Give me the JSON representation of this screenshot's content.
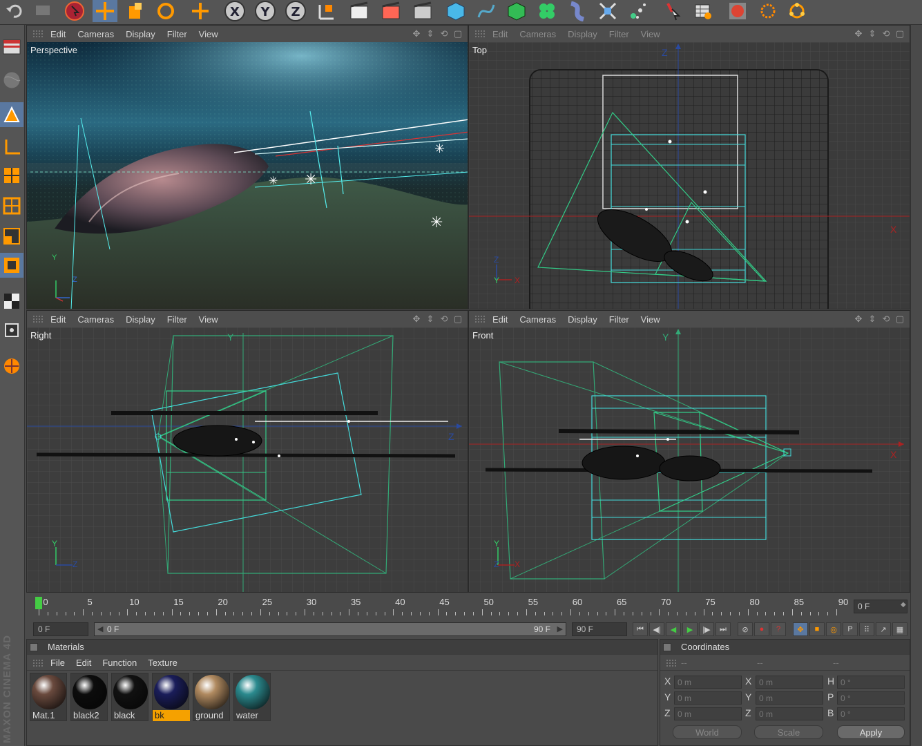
{
  "app": {
    "brand_text": "MAXON CINEMA 4D"
  },
  "toolbar": {
    "buttons": [
      "undo-icon",
      "redo-icon",
      "live-selection-icon",
      "move-icon",
      "scale-icon",
      "rotate-icon",
      "add-object-icon",
      "x-axis-lock-icon",
      "y-axis-lock-icon",
      "z-axis-lock-icon",
      "coordinate-system-icon",
      "render-view-icon",
      "render-picture-viewer-icon",
      "render-settings-icon",
      "cube-primitive-icon",
      "spline-pen-icon",
      "subdivision-surface-icon",
      "cloner-icon",
      "deformer-icon",
      "scene-object-icon",
      "particle-icon",
      "light-icon",
      "camera-icon",
      "tag-icon",
      "environment-icon",
      "sun-icon",
      "atom-icon"
    ]
  },
  "viewport_menu": [
    "Edit",
    "Cameras",
    "Display",
    "Filter",
    "View"
  ],
  "viewports": {
    "perspective": {
      "label": "Perspective"
    },
    "top": {
      "label": "Top"
    },
    "right": {
      "label": "Right"
    },
    "front": {
      "label": "Front"
    }
  },
  "axes": {
    "x": "X",
    "y": "Y",
    "z": "Z"
  },
  "timeline": {
    "ticks": [
      "0",
      "5",
      "10",
      "15",
      "20",
      "25",
      "30",
      "35",
      "40",
      "45",
      "50",
      "55",
      "60",
      "65",
      "70",
      "75",
      "80",
      "85",
      "90"
    ],
    "current_frame": "0 F"
  },
  "transport": {
    "start_frame": "0 F",
    "range_start": "0 F",
    "range_end": "90 F",
    "end_frame": "90 F"
  },
  "materials_panel": {
    "title": "Materials",
    "menu": [
      "File",
      "Edit",
      "Function",
      "Texture"
    ],
    "items": [
      {
        "name": "Mat.1",
        "color": "#6a4a3e"
      },
      {
        "name": "black2",
        "color": "#0c0c0c"
      },
      {
        "name": "black",
        "color": "#111111"
      },
      {
        "name": "bk",
        "color": "#1a1d5a",
        "selected": true
      },
      {
        "name": "ground",
        "color": "#b08a60"
      },
      {
        "name": "water",
        "color": "#2b8a8e"
      }
    ]
  },
  "coordinates_panel": {
    "title": "Coordinates",
    "header": [
      "--",
      "--",
      "--"
    ],
    "rows": [
      {
        "pos_label": "X",
        "pos": "0 m",
        "size_label": "X",
        "size": "0 m",
        "rot_label": "H",
        "rot": "0 °"
      },
      {
        "pos_label": "Y",
        "pos": "0 m",
        "size_label": "Y",
        "size": "0 m",
        "rot_label": "P",
        "rot": "0 °"
      },
      {
        "pos_label": "Z",
        "pos": "0 m",
        "size_label": "Z",
        "size": "0 m",
        "rot_label": "B",
        "rot": "0 °"
      }
    ],
    "mode": "World",
    "transform": "Scale",
    "apply": "Apply"
  }
}
